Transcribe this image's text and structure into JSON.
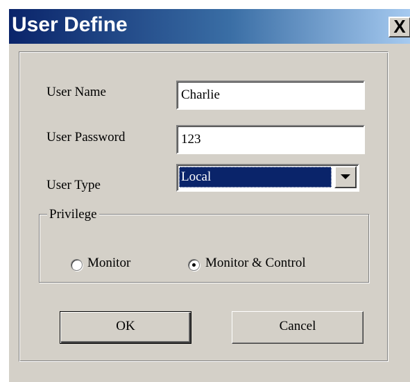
{
  "window": {
    "title": "User Define",
    "close_label": "X"
  },
  "form": {
    "user_name_label": "User Name",
    "user_name_value": "Charlie",
    "user_password_label": "User Password",
    "user_password_value": "123",
    "user_type_label": "User Type",
    "user_type_value": "Local"
  },
  "privilege": {
    "legend": "Privilege",
    "options": [
      {
        "label": "Monitor",
        "selected": false
      },
      {
        "label": "Monitor & Control",
        "selected": true
      }
    ]
  },
  "buttons": {
    "ok_label": "OK",
    "cancel_label": "Cancel"
  },
  "colors": {
    "titlebar_start": "#0a246a",
    "titlebar_end": "#a6caf0",
    "dialog_bg": "#d4d0c8",
    "selection": "#0a246a"
  }
}
